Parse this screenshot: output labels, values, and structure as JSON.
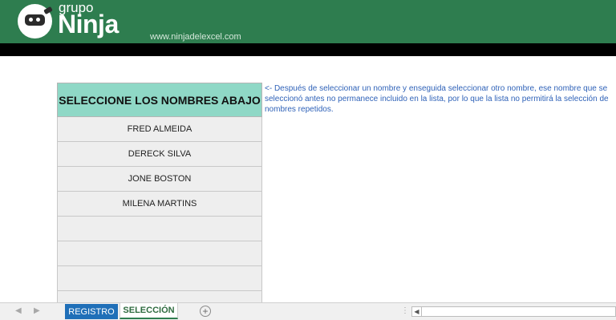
{
  "header": {
    "logo_small": "grupo",
    "logo_big": "Ninja",
    "url": "www.ninjadelexcel.com",
    "color": "#2e7d4f"
  },
  "table": {
    "title": "SELECCIONE LOS NOMBRES ABAJO",
    "rows": [
      "FRED ALMEIDA",
      "DERECK SILVA",
      "JONE BOSTON",
      "MILENA MARTINS",
      "",
      "",
      "",
      ""
    ]
  },
  "note": "<-  Después de seleccionar un nombre y enseguida seleccionar otro nombre, ese nombre que se seleccionó antes no permanece incluido en la lista, por lo que la lista no permitirá la selección de nombres repetidos.",
  "sheets": {
    "tab1": "REGISTRO",
    "tab2": "SELECCIÓN",
    "add": "+"
  },
  "icons": {
    "prev": "chevron-left-icon",
    "next": "chevron-right-icon",
    "add": "plus-circle-icon"
  }
}
